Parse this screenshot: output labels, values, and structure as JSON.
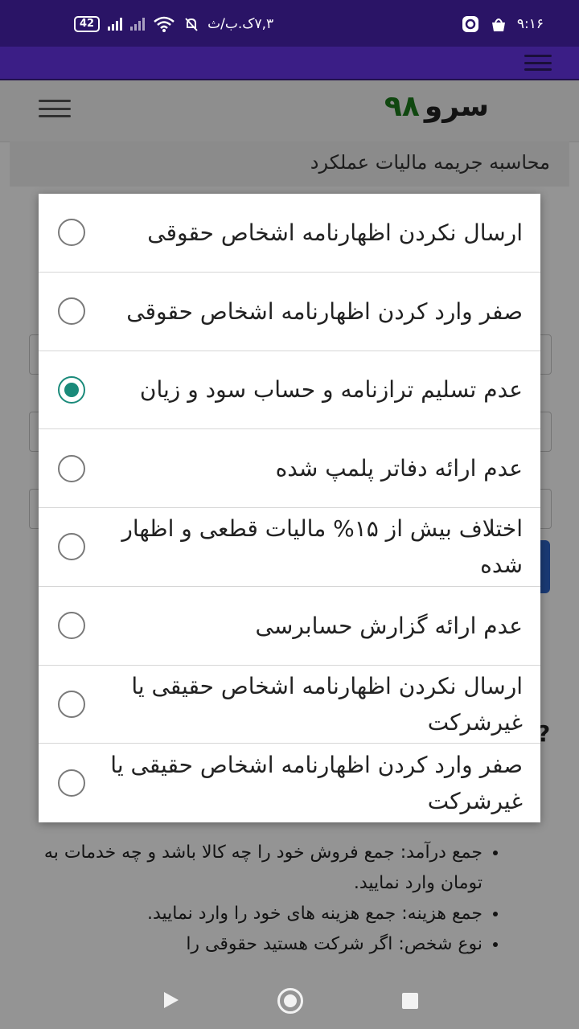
{
  "status_bar": {
    "time": "۹:۱۶",
    "network_speed": "۷,۳ک.ب/ث",
    "battery": "42",
    "icons": [
      "battery-icon",
      "signal-icon",
      "signal-icon-2",
      "wifi-icon",
      "mute-icon",
      "app-notification-icon",
      "shop-icon"
    ]
  },
  "site": {
    "logo_text": "سرو",
    "logo_number": "۹۸",
    "page_title": "محاسبه جریمه مالیات عملکرد"
  },
  "background_list": [
    "جمع درآمد: جمع فروش خود را چه کالا باشد و چه خدمات به تومان وارد نمایید.",
    "جمع هزینه: جمع هزینه های خود را وارد نمایید.",
    "نوع شخص: اگر شرکت هستید حقوقی را"
  ],
  "background_question_mark": "?",
  "dialog": {
    "selected_index": 2,
    "options": [
      {
        "label": "ارسال نکردن اظهارنامه اشخاص حقوقی"
      },
      {
        "label": "صفر وارد کردن اظهارنامه اشخاص حقوقی"
      },
      {
        "label": "عدم تسلیم ترازنامه و حساب سود و زیان"
      },
      {
        "label": "عدم ارائه دفاتر پلمپ شده"
      },
      {
        "label": "اختلاف بیش از ۱۵% مالیات قطعی و اظهار شده"
      },
      {
        "label": "عدم ارائه گزارش حسابرسی"
      },
      {
        "label": "ارسال نکردن اظهارنامه اشخاص حقیقی یا غیرشرکت"
      },
      {
        "label": "صفر وارد کردن اظهارنامه اشخاص حقیقی یا غیرشرکت"
      }
    ]
  },
  "colors": {
    "status_bar": "#2a1466",
    "app_bar": "#3b1e86",
    "radio_checked": "#1a8a7a",
    "logo_number": "#1d7a1d"
  }
}
